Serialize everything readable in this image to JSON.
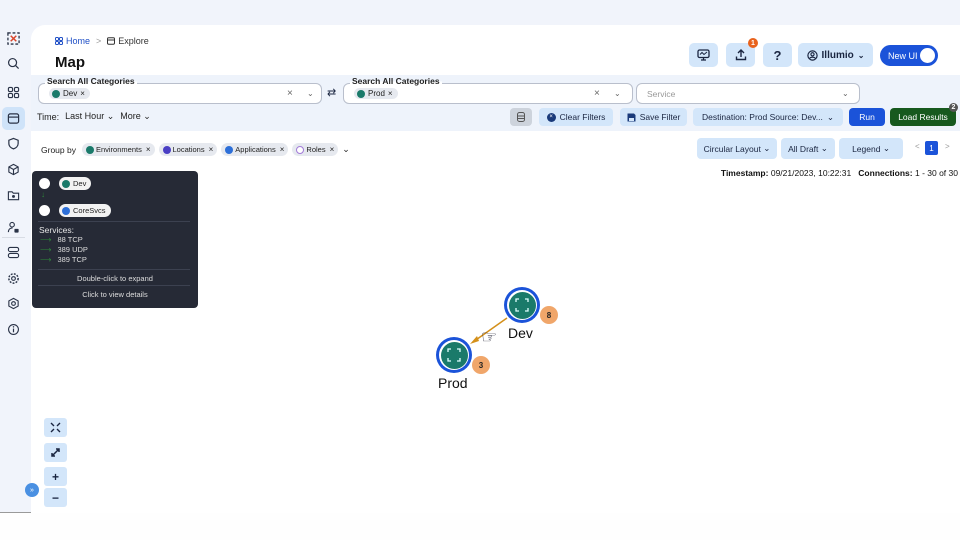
{
  "sidebar": {
    "items": [
      {
        "name": "logo-icon",
        "active": false
      },
      {
        "name": "search-icon",
        "active": false
      },
      {
        "name": "dashboard-grid-icon",
        "active": false
      },
      {
        "name": "explore-icon",
        "active": true
      },
      {
        "name": "shield-icon",
        "active": false
      },
      {
        "name": "cube-icon",
        "active": false
      },
      {
        "name": "folder-icon",
        "active": false
      },
      {
        "name": "user-lock-icon",
        "active": false
      },
      {
        "name": "server-icon",
        "active": false
      },
      {
        "name": "settings-icon",
        "active": false
      },
      {
        "name": "hexagon-settings-icon",
        "active": false
      },
      {
        "name": "info-icon",
        "active": false
      }
    ]
  },
  "breadcrumb": {
    "home": "Home",
    "separator": ">",
    "current": "Explore"
  },
  "page_title": "Map",
  "topbar": {
    "upload_badge": "1",
    "help_label": "?",
    "user_label": "Illumio",
    "toggle_label": "New UI"
  },
  "filters": {
    "source": {
      "label": "Search All Categories",
      "chip": "Dev"
    },
    "destination": {
      "label": "Search All Categories",
      "chip": "Prod"
    },
    "service": {
      "placeholder": "Service"
    },
    "time_label": "Time:",
    "time_value": "Last Hour",
    "more_label": "More",
    "clear_label": "Clear Filters",
    "save_label": "Save Filter",
    "saved_query": "Destination: Prod Source: Dev...",
    "run_label": "Run",
    "load_label": "Load Results",
    "load_badge": "2"
  },
  "groupby": {
    "label": "Group by",
    "chips": [
      {
        "label": "Environments",
        "color": "#1a7a6a"
      },
      {
        "label": "Locations",
        "color": "#4b3fc4"
      },
      {
        "label": "Applications",
        "color": "#2d6fd8"
      },
      {
        "label": "Roles",
        "color": "#a27ad8"
      }
    ]
  },
  "view": {
    "layout_label": "Circular Layout",
    "draft_label": "All Draft",
    "legend_label": "Legend",
    "page": "1",
    "prev": "<",
    "next": ">"
  },
  "meta": {
    "timestamp_label": "Timestamp:",
    "timestamp": "09/21/2023, 10:22:31",
    "connections_label": "Connections:",
    "connections": "1 - 30 of 30"
  },
  "tooltip": {
    "from": "Dev",
    "to": "CoreSvcs",
    "services_label": "Services:",
    "services": [
      "88 TCP",
      "389 UDP",
      "389 TCP"
    ],
    "hint_expand": "Double-click to expand",
    "hint_details": "Click to view details"
  },
  "graph": {
    "nodes": [
      {
        "label": "Dev",
        "count": "8"
      },
      {
        "label": "Prod",
        "count": "3"
      }
    ],
    "edge_color": "#d4901a"
  },
  "controls": {
    "zoom_in": "+",
    "zoom_out": "−",
    "expand_toggle": "»"
  }
}
